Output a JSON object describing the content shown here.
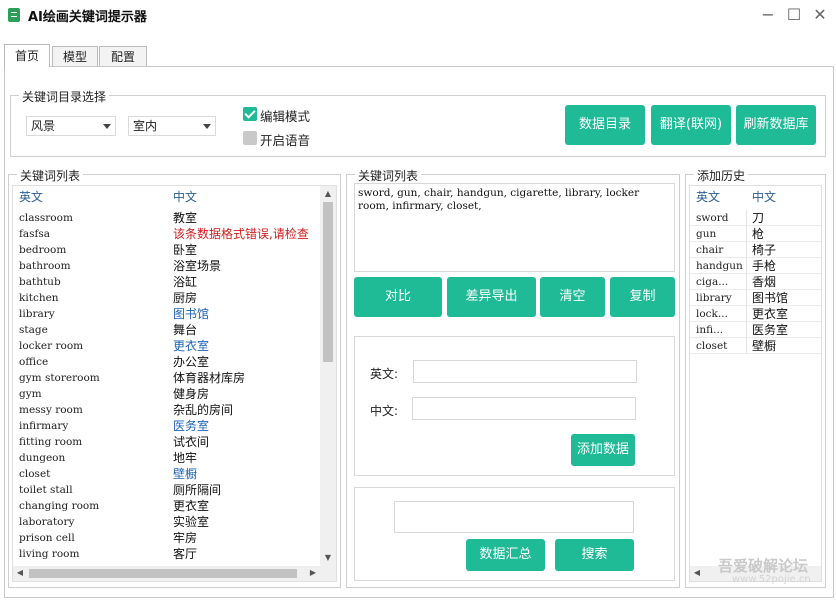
{
  "window": {
    "title": "AI绘画关键词提示器",
    "controls": {
      "minimize": "−",
      "maximize": "☐",
      "close": "✕"
    }
  },
  "tabs": [
    {
      "label": "首页",
      "active": true
    },
    {
      "label": "模型",
      "active": false
    },
    {
      "label": "配置",
      "active": false
    }
  ],
  "catalog": {
    "title": "关键词目录选择",
    "category_value": "风景",
    "subcategory_value": "室内",
    "edit_mode_label": "编辑模式",
    "edit_mode_checked": true,
    "voice_label": "开启语音",
    "voice_checked": false,
    "buttons": {
      "data_dir": "数据目录",
      "translate": "翻译(联网)",
      "refresh": "刷新数据库"
    }
  },
  "keyword_list": {
    "title": "关键词列表",
    "col_en": "英文",
    "col_zh": "中文",
    "rows": [
      {
        "en": "classroom",
        "zh": "教室",
        "style": "normal"
      },
      {
        "en": "fasfsa",
        "zh": "该条数据格式错误,请检查",
        "style": "red"
      },
      {
        "en": "bedroom",
        "zh": "卧室",
        "style": "normal"
      },
      {
        "en": "bathroom",
        "zh": "浴室场景",
        "style": "normal"
      },
      {
        "en": "bathtub",
        "zh": "浴缸",
        "style": "normal"
      },
      {
        "en": "kitchen",
        "zh": "厨房",
        "style": "normal"
      },
      {
        "en": "library",
        "zh": "图书馆",
        "style": "blue"
      },
      {
        "en": "stage",
        "zh": "舞台",
        "style": "normal"
      },
      {
        "en": "locker room",
        "zh": "更衣室",
        "style": "blue"
      },
      {
        "en": "office",
        "zh": "办公室",
        "style": "normal"
      },
      {
        "en": "gym storeroom",
        "zh": "体育器材库房",
        "style": "normal"
      },
      {
        "en": "gym",
        "zh": "健身房",
        "style": "normal"
      },
      {
        "en": "messy room",
        "zh": "杂乱的房间",
        "style": "normal"
      },
      {
        "en": "infirmary",
        "zh": "医务室",
        "style": "blue"
      },
      {
        "en": "fitting room",
        "zh": "试衣间",
        "style": "normal"
      },
      {
        "en": "dungeon",
        "zh": "地牢",
        "style": "normal"
      },
      {
        "en": "closet",
        "zh": "壁橱",
        "style": "blue"
      },
      {
        "en": "toilet stall",
        "zh": "厕所隔间",
        "style": "normal"
      },
      {
        "en": "changing room",
        "zh": "更衣室",
        "style": "normal"
      },
      {
        "en": "laboratory",
        "zh": "实验室",
        "style": "normal"
      },
      {
        "en": "prison cell",
        "zh": "牢房",
        "style": "normal"
      },
      {
        "en": "living room",
        "zh": "客厅",
        "style": "normal"
      }
    ]
  },
  "prompt_panel": {
    "title": "关键词列表",
    "text": "sword, gun, chair, handgun, cigarette, library, locker room, infirmary, closet,",
    "buttons": {
      "compare": "对比",
      "diff_export": "差异导出",
      "clear": "清空",
      "copy": "复制"
    }
  },
  "add_form": {
    "en_label": "英文:",
    "en_value": "",
    "zh_label": "中文:",
    "zh_value": "",
    "add_button": "添加数据"
  },
  "search_form": {
    "search_value": "",
    "summary_button": "数据汇总",
    "search_button": "搜索"
  },
  "history": {
    "title": "添加历史",
    "col_en": "英文",
    "col_zh": "中文",
    "rows": [
      {
        "en": "sword",
        "zh": "刀"
      },
      {
        "en": "gun",
        "zh": "枪"
      },
      {
        "en": "chair",
        "zh": "椅子"
      },
      {
        "en": "handgun",
        "zh": "手枪"
      },
      {
        "en": "ciga...",
        "zh": "香烟"
      },
      {
        "en": "library",
        "zh": "图书馆"
      },
      {
        "en": "lock...",
        "zh": "更衣室"
      },
      {
        "en": "infi...",
        "zh": "医务室"
      },
      {
        "en": "closet",
        "zh": "壁橱"
      }
    ]
  },
  "watermark": {
    "text": "吾爱破解论坛",
    "url": "www.52pojie.cn"
  },
  "colors": {
    "accent": "#1fba96",
    "header_text": "#2b5f93",
    "link_blue": "#1c63b7",
    "error_red": "#d11c1c"
  }
}
